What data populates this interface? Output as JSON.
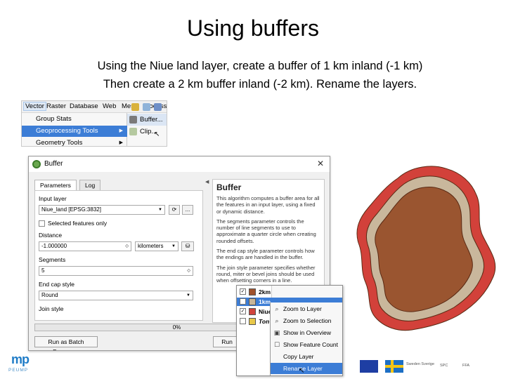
{
  "slide": {
    "title": "Using buffers",
    "line1": "Using the Niue land layer, create a buffer of 1 km inland (-1 km)",
    "line2": "Then create a 2 km buffer inland (-2 km). Rename the layers."
  },
  "menu": {
    "bar": [
      "Vector",
      "Raster",
      "Database",
      "Web",
      "Mesh",
      "Processi"
    ],
    "items": [
      "Group Stats",
      "Geoprocessing Tools",
      "Geometry Tools"
    ],
    "sub_items": [
      "Buffer...",
      "Clip..."
    ]
  },
  "dialog": {
    "title": "Buffer",
    "tabs": [
      "Parameters",
      "Log"
    ],
    "input_layer_label": "Input layer",
    "input_layer_value": "Niue_land [EPSG:3832]",
    "selected_only_label": "Selected features only",
    "distance_label": "Distance",
    "distance_value": "-1.000000",
    "distance_unit": "kilometers",
    "segments_label": "Segments",
    "segments_value": "5",
    "end_cap_label": "End cap style",
    "end_cap_value": "Round",
    "join_label": "Join style",
    "progress_text": "0%",
    "progress": 0,
    "batch_button": "Run as Batch Process...",
    "run_button": "Run",
    "ellipsis_button": "...",
    "help_title": "Buffer",
    "help_p1": "This algorithm computes a buffer area for all the features in an input layer, using a fixed or dynamic distance.",
    "help_p2": "The segments parameter controls the number of line segments to use to approximate a quarter circle when creating rounded offsets.",
    "help_p3": "The end cap style parameter controls how the endings are handled in the buffer.",
    "help_p4": "The join style parameter specifies whether round, miter or bevel joins should be used when offsetting corners in a line."
  },
  "layers": {
    "rows": [
      {
        "name": "2km",
        "color": "#a0522d",
        "checked": true
      },
      {
        "name": "1km",
        "color": "#c8b69a",
        "checked": true
      },
      {
        "name": "Niue",
        "color": "#d0443c",
        "checked": true
      },
      {
        "name": "Ton",
        "color": "#e8c84a",
        "checked": false
      }
    ],
    "context_menu": [
      "Zoom to Layer",
      "Zoom to Selection",
      "Show in Overview",
      "Show Feature Count",
      "Copy Layer",
      "Rename Layer"
    ],
    "selected_item": "Rename Layer"
  },
  "map": {
    "colors": {
      "outer": "#d2413a",
      "middle": "#c9b79c",
      "inner": "#9a5530",
      "outline": "#5a2a14"
    }
  },
  "footer": {
    "logo_mark": "mp",
    "logo_text": "PEUMP",
    "partner_text_1": "Sweden Sverige",
    "partner_text_2": "SPC",
    "partner_text_3": "FFA"
  },
  "colors": {
    "accent": "#3c7dd6"
  }
}
